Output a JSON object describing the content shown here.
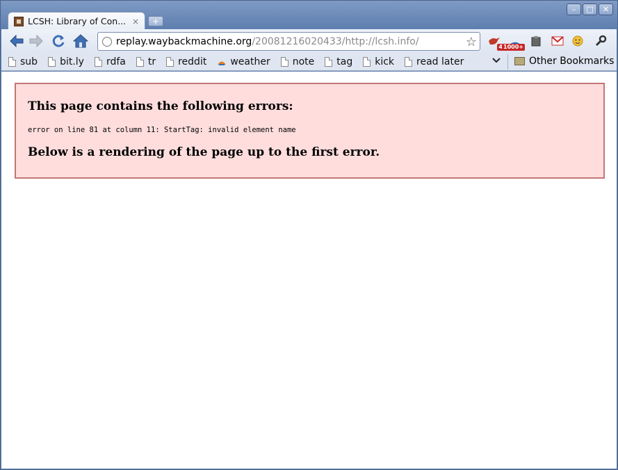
{
  "window": {
    "controls": [
      "–",
      "□",
      "✕"
    ]
  },
  "tab": {
    "title": "LCSH: Library of Con...",
    "close": "×",
    "new_tab": "+"
  },
  "toolbar": {
    "back_icon": "back-arrow-icon",
    "forward_icon": "forward-arrow-icon",
    "reload_icon": "reload-icon",
    "home_icon": "home-icon",
    "url_host": "replay.waybackmachine.org",
    "url_path": "/20081216020433/http://lcsh.info/",
    "star": "☆",
    "extensions": [
      {
        "name": "twitter-bird-icon",
        "badge": "4"
      },
      {
        "name": "rss-feed-icon",
        "badge": "1000+"
      },
      {
        "name": "tag-icon",
        "badge": ""
      },
      {
        "name": "gmail-icon",
        "badge": ""
      },
      {
        "name": "smiley-icon",
        "badge": ""
      },
      {
        "name": "wrench-icon",
        "badge": ""
      }
    ]
  },
  "bookmarks": {
    "items": [
      "sub",
      "bit.ly",
      "rdfa",
      "tr",
      "reddit",
      "weather",
      "note",
      "tag",
      "kick",
      "read later"
    ],
    "other": "Other Bookmarks"
  },
  "error": {
    "heading": "This page contains the following errors:",
    "detail": "error on line 81 at column 11: StartTag: invalid element name",
    "footer": "Below is a rendering of the page up to the first error."
  },
  "colors": {
    "error_bg": "#ffdddd",
    "error_border": "#c27676"
  }
}
